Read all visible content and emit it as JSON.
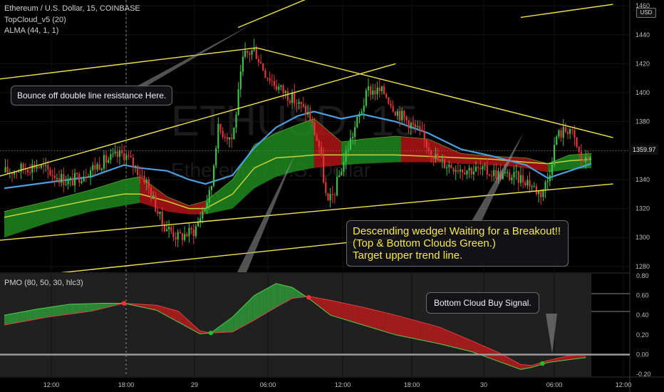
{
  "header": {
    "symbol_line": "Ethereum / U.S. Dollar, 15, COINBASE",
    "indicator_1": "TopCloud_v5 (20)",
    "indicator_2": "ALMA (44, 1, 1)",
    "oscillator_label": "PMO (80, 50, 30, hlc3)",
    "currency_badge": "USD",
    "current_price": "1359.97",
    "watermark_big": "ETHUSD, 15",
    "watermark_small": "Ethereum / U.S. Dollar"
  },
  "annotations": {
    "bounce": "Bounce off double line resistance Here.",
    "wedge_lines": [
      "Descending wedge! Waiting for a Breakout!!",
      "(Top & Bottom Clouds Green.)",
      "Target upper trend line."
    ],
    "buy_signal": "Bottom Cloud Buy Signal."
  },
  "colors": {
    "background": "#000000",
    "trendline": "#f2e64a",
    "up_candle": "#3fbf4a",
    "down_candle": "#e0363a",
    "alma": "#4a9fe0",
    "cloud_green": "#1f8a1f",
    "cloud_red": "#b01515",
    "pmo_panel": "#1a1a1a",
    "signal_dot_red": "#ff3030",
    "signal_dot_green": "#20c020"
  },
  "chart_data": [
    {
      "type": "candlestick",
      "title": "Ethereum / U.S. Dollar, 15, COINBASE",
      "y_ticks": [
        1280,
        1300,
        1320,
        1340,
        1360,
        1380,
        1400,
        1420,
        1440,
        1460
      ],
      "ylim": [
        1276,
        1464
      ],
      "x_ticks": [
        "12:00",
        "18:00",
        "29",
        "06:00",
        "12:00",
        "18:00",
        "30",
        "06:00",
        "12:00"
      ],
      "current_price": 1359.97,
      "price_path": [
        {
          "x": 0,
          "p": 1345
        },
        {
          "x": 3,
          "p": 1350
        },
        {
          "x": 6,
          "p": 1338
        },
        {
          "x": 9,
          "p": 1352
        },
        {
          "x": 11,
          "p": 1358
        },
        {
          "x": 13,
          "p": 1340
        },
        {
          "x": 14.5,
          "p": 1310
        },
        {
          "x": 16,
          "p": 1300
        },
        {
          "x": 17.5,
          "p": 1305
        },
        {
          "x": 19,
          "p": 1332
        },
        {
          "x": 19.6,
          "p": 1375
        },
        {
          "x": 20.3,
          "p": 1372
        },
        {
          "x": 21,
          "p": 1368
        },
        {
          "x": 22,
          "p": 1425
        },
        {
          "x": 23,
          "p": 1430
        },
        {
          "x": 24,
          "p": 1414
        },
        {
          "x": 25,
          "p": 1405
        },
        {
          "x": 26.5,
          "p": 1396
        },
        {
          "x": 28,
          "p": 1385
        },
        {
          "x": 29,
          "p": 1362
        },
        {
          "x": 29.7,
          "p": 1322
        },
        {
          "x": 30.3,
          "p": 1330
        },
        {
          "x": 31.5,
          "p": 1360
        },
        {
          "x": 33.5,
          "p": 1402
        },
        {
          "x": 35,
          "p": 1400
        },
        {
          "x": 36,
          "p": 1388
        },
        {
          "x": 38,
          "p": 1374
        },
        {
          "x": 40,
          "p": 1352
        },
        {
          "x": 42,
          "p": 1348
        },
        {
          "x": 44,
          "p": 1346
        },
        {
          "x": 46,
          "p": 1343
        },
        {
          "x": 48,
          "p": 1340
        },
        {
          "x": 49.3,
          "p": 1330
        },
        {
          "x": 50,
          "p": 1340
        },
        {
          "x": 50.8,
          "p": 1370
        },
        {
          "x": 52,
          "p": 1376
        },
        {
          "x": 53,
          "p": 1355
        },
        {
          "x": 53.5,
          "p": 1352
        },
        {
          "x": 54,
          "p": 1360
        }
      ],
      "alma_path": [
        {
          "x": 0,
          "p": 1334
        },
        {
          "x": 4,
          "p": 1338
        },
        {
          "x": 8,
          "p": 1342
        },
        {
          "x": 11,
          "p": 1350
        },
        {
          "x": 12.5,
          "p": 1348
        },
        {
          "x": 15,
          "p": 1346
        },
        {
          "x": 17,
          "p": 1340
        },
        {
          "x": 18.5,
          "p": 1337
        },
        {
          "x": 21,
          "p": 1343
        },
        {
          "x": 23,
          "p": 1362
        },
        {
          "x": 25,
          "p": 1376
        },
        {
          "x": 27,
          "p": 1384
        },
        {
          "x": 28.5,
          "p": 1387
        },
        {
          "x": 31,
          "p": 1382
        },
        {
          "x": 33,
          "p": 1385
        },
        {
          "x": 36,
          "p": 1380
        },
        {
          "x": 39,
          "p": 1372
        },
        {
          "x": 42,
          "p": 1361
        },
        {
          "x": 45,
          "p": 1356
        },
        {
          "x": 48,
          "p": 1350
        },
        {
          "x": 50,
          "p": 1341
        },
        {
          "x": 52,
          "p": 1346
        },
        {
          "x": 54,
          "p": 1351
        }
      ],
      "cloud_mid_path": [
        {
          "x": 0,
          "p": 1314
        },
        {
          "x": 4,
          "p": 1320
        },
        {
          "x": 8,
          "p": 1326
        },
        {
          "x": 11,
          "p": 1330
        },
        {
          "x": 12.5,
          "p": 1330
        },
        {
          "x": 15,
          "p": 1325
        },
        {
          "x": 17,
          "p": 1320
        },
        {
          "x": 18.5,
          "p": 1320
        },
        {
          "x": 21,
          "p": 1330
        },
        {
          "x": 23,
          "p": 1348
        },
        {
          "x": 25,
          "p": 1355
        },
        {
          "x": 27,
          "p": 1356
        },
        {
          "x": 28.5,
          "p": 1357
        },
        {
          "x": 31,
          "p": 1357
        },
        {
          "x": 33,
          "p": 1357
        },
        {
          "x": 36,
          "p": 1357
        },
        {
          "x": 39,
          "p": 1356
        },
        {
          "x": 42,
          "p": 1355
        },
        {
          "x": 45,
          "p": 1354
        },
        {
          "x": 48,
          "p": 1352
        },
        {
          "x": 50,
          "p": 1351
        },
        {
          "x": 52,
          "p": 1353
        },
        {
          "x": 54,
          "p": 1354
        }
      ],
      "cloud_top_path": [
        {
          "x": 0,
          "p": 1318
        },
        {
          "x": 4,
          "p": 1325
        },
        {
          "x": 8,
          "p": 1333
        },
        {
          "x": 11,
          "p": 1340
        },
        {
          "x": 12.5,
          "p": 1342
        },
        {
          "x": 15,
          "p": 1328
        },
        {
          "x": 17,
          "p": 1322
        },
        {
          "x": 18.5,
          "p": 1325
        },
        {
          "x": 21,
          "p": 1340
        },
        {
          "x": 23,
          "p": 1364
        },
        {
          "x": 25,
          "p": 1372
        },
        {
          "x": 27,
          "p": 1378
        },
        {
          "x": 28.5,
          "p": 1382
        },
        {
          "x": 31,
          "p": 1366
        },
        {
          "x": 33,
          "p": 1368
        },
        {
          "x": 36,
          "p": 1370
        },
        {
          "x": 39,
          "p": 1368
        },
        {
          "x": 42,
          "p": 1358
        },
        {
          "x": 45,
          "p": 1356
        },
        {
          "x": 48,
          "p": 1355
        },
        {
          "x": 50,
          "p": 1351
        },
        {
          "x": 52,
          "p": 1357
        },
        {
          "x": 54,
          "p": 1358
        }
      ],
      "cloud_bottom_path": [
        {
          "x": 0,
          "p": 1300
        },
        {
          "x": 4,
          "p": 1310
        },
        {
          "x": 8,
          "p": 1318
        },
        {
          "x": 11,
          "p": 1322
        },
        {
          "x": 12.5,
          "p": 1324
        },
        {
          "x": 15,
          "p": 1318
        },
        {
          "x": 17,
          "p": 1316
        },
        {
          "x": 18.5,
          "p": 1316
        },
        {
          "x": 21,
          "p": 1320
        },
        {
          "x": 23,
          "p": 1334
        },
        {
          "x": 25,
          "p": 1342
        },
        {
          "x": 27,
          "p": 1346
        },
        {
          "x": 28.5,
          "p": 1348
        },
        {
          "x": 31,
          "p": 1350
        },
        {
          "x": 33,
          "p": 1351
        },
        {
          "x": 36,
          "p": 1352
        },
        {
          "x": 39,
          "p": 1352
        },
        {
          "x": 42,
          "p": 1351
        },
        {
          "x": 45,
          "p": 1350
        },
        {
          "x": 48,
          "p": 1348
        },
        {
          "x": 50,
          "p": 1345
        },
        {
          "x": 52,
          "p": 1347
        },
        {
          "x": 54,
          "p": 1348
        }
      ],
      "cloud_segments": [
        {
          "from": 0,
          "to": 12.5,
          "color": "green"
        },
        {
          "from": 12.5,
          "to": 18.5,
          "color": "red"
        },
        {
          "from": 18.5,
          "to": 28.5,
          "color": "green"
        },
        {
          "from": 28.5,
          "to": 31,
          "color": "red"
        },
        {
          "from": 31,
          "to": 36.5,
          "color": "green"
        },
        {
          "from": 36.5,
          "to": 50,
          "color": "red"
        },
        {
          "from": 50,
          "to": 54,
          "color": "green"
        }
      ],
      "trendlines": [
        {
          "from": {
            "x": -2,
            "p": 1408
          },
          "to": {
            "x": 23.2,
            "p": 1431
          }
        },
        {
          "from": {
            "x": 21.5,
            "p": 1445
          },
          "to": {
            "x": 60,
            "p": 1565
          }
        },
        {
          "from": {
            "x": -2,
            "p": 1339
          },
          "to": {
            "x": 36,
            "p": 1420
          }
        },
        {
          "from": {
            "x": 23.2,
            "p": 1431
          },
          "to": {
            "x": 56,
            "p": 1369
          }
        },
        {
          "from": {
            "x": -2,
            "p": 1297
          },
          "to": {
            "x": 56,
            "p": 1337
          }
        },
        {
          "from": {
            "x": -2,
            "p": 1270
          },
          "to": {
            "x": 36,
            "p": 1300
          }
        },
        {
          "from": {
            "x": 47.5,
            "p": 1452
          },
          "to": {
            "x": 56,
            "p": 1461
          }
        }
      ]
    },
    {
      "type": "area",
      "title": "PMO (80, 50, 30, hlc3)",
      "y_ticks": [
        -0.2,
        0.0,
        0.2,
        0.4,
        0.6,
        0.8
      ],
      "ylim": [
        -0.22,
        0.82
      ],
      "zero_line": 0.0,
      "pmo": [
        {
          "x": 0,
          "v": 0.4
        },
        {
          "x": 3,
          "v": 0.46
        },
        {
          "x": 6,
          "v": 0.51
        },
        {
          "x": 9,
          "v": 0.52
        },
        {
          "x": 11,
          "v": 0.52
        },
        {
          "x": 14,
          "v": 0.45
        },
        {
          "x": 16,
          "v": 0.33
        },
        {
          "x": 18,
          "v": 0.21
        },
        {
          "x": 19,
          "v": 0.22
        },
        {
          "x": 21,
          "v": 0.38
        },
        {
          "x": 23,
          "v": 0.6
        },
        {
          "x": 25,
          "v": 0.72
        },
        {
          "x": 26.5,
          "v": 0.68
        },
        {
          "x": 28,
          "v": 0.57
        },
        {
          "x": 30,
          "v": 0.4
        },
        {
          "x": 33,
          "v": 0.3
        },
        {
          "x": 36,
          "v": 0.2
        },
        {
          "x": 40,
          "v": 0.11
        },
        {
          "x": 43,
          "v": 0.03
        },
        {
          "x": 45.5,
          "v": -0.07
        },
        {
          "x": 47.5,
          "v": -0.15
        },
        {
          "x": 48.5,
          "v": -0.13
        },
        {
          "x": 50,
          "v": -0.08
        },
        {
          "x": 52,
          "v": -0.05
        },
        {
          "x": 53.5,
          "v": -0.03
        }
      ],
      "signal": [
        {
          "x": 0,
          "v": 0.3
        },
        {
          "x": 4,
          "v": 0.38
        },
        {
          "x": 8,
          "v": 0.44
        },
        {
          "x": 11,
          "v": 0.52
        },
        {
          "x": 14,
          "v": 0.5
        },
        {
          "x": 16,
          "v": 0.44
        },
        {
          "x": 18,
          "v": 0.24
        },
        {
          "x": 19,
          "v": 0.22
        },
        {
          "x": 21,
          "v": 0.23
        },
        {
          "x": 23,
          "v": 0.35
        },
        {
          "x": 25,
          "v": 0.48
        },
        {
          "x": 26.5,
          "v": 0.57
        },
        {
          "x": 28,
          "v": 0.59
        },
        {
          "x": 30,
          "v": 0.55
        },
        {
          "x": 33,
          "v": 0.48
        },
        {
          "x": 36,
          "v": 0.4
        },
        {
          "x": 40,
          "v": 0.28
        },
        {
          "x": 43,
          "v": 0.14
        },
        {
          "x": 45.5,
          "v": 0.02
        },
        {
          "x": 47.5,
          "v": -0.1
        },
        {
          "x": 48.5,
          "v": -0.11
        },
        {
          "x": 50,
          "v": -0.06
        },
        {
          "x": 52,
          "v": -0.01
        },
        {
          "x": 53.5,
          "v": 0.0
        }
      ],
      "crossover_dots": [
        {
          "x": 11,
          "v": 0.52,
          "color": "red"
        },
        {
          "x": 19,
          "v": 0.22,
          "color": "green"
        },
        {
          "x": 28,
          "v": 0.58,
          "color": "red"
        },
        {
          "x": 49.5,
          "v": -0.09,
          "color": "green"
        }
      ]
    }
  ]
}
